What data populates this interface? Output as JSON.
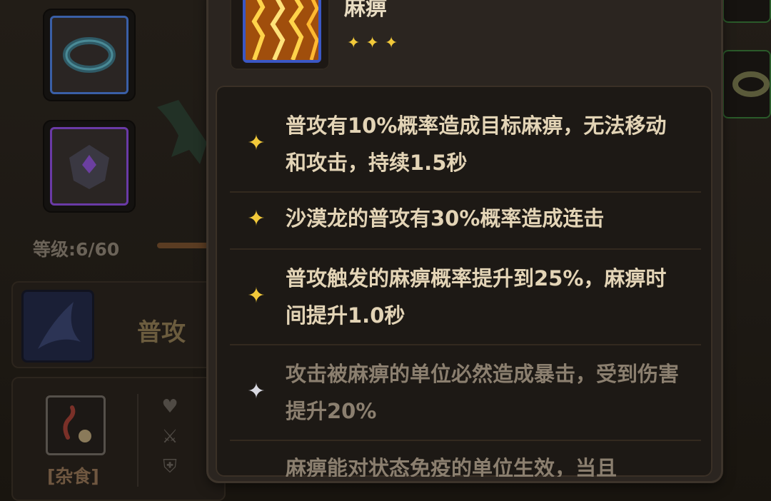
{
  "colors": {
    "text_active": "#e3d4b6",
    "text_locked": "#8b7f6f",
    "star_active": "#f2c93a",
    "star_locked": "#d8d8e0"
  },
  "background": {
    "level_label": "等级:6/60",
    "skill_name": "普攻",
    "diet_label": "[杂食]"
  },
  "tooltip": {
    "skill_title": "麻痹",
    "stars": "✦✦✦",
    "entries": [
      {
        "text": "普攻有10%概率造成目标麻痹，无法移动和攻击，持续1.5秒",
        "icon": "gold-star-icon"
      },
      {
        "text": "沙漠龙的普攻有30%概率造成连击",
        "icon": "gold-star-icon"
      },
      {
        "text": "普攻触发的麻痹概率提升到25%，麻痹时间提升1.0秒",
        "icon": "gold-star-icon"
      },
      {
        "text": "攻击被麻痹的单位必然造成暴击，受到伤害提升20%",
        "icon": "silver-star-icon"
      },
      {
        "text": "麻痹能对状态免疫的单位生效，当且",
        "icon": "silver-star-icon"
      }
    ]
  }
}
